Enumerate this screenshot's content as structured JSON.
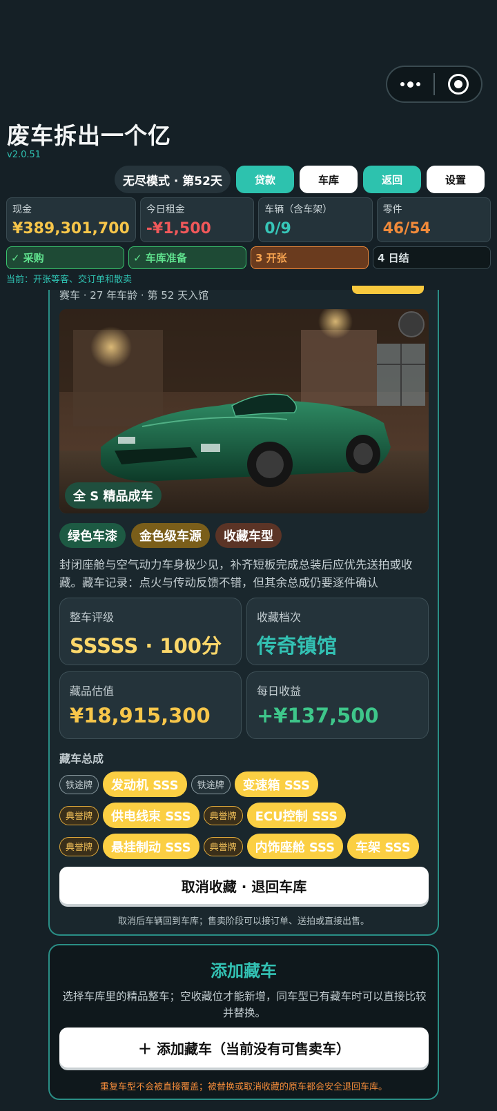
{
  "app": {
    "title": "废车拆出一个亿",
    "version": "v2.0.51"
  },
  "topbar": {
    "mode": "无尽模式 · 第52天",
    "buttons": {
      "loan": "贷款",
      "garage": "车库",
      "back": "返回",
      "settings": "设置"
    }
  },
  "stats": [
    {
      "label": "现金",
      "value": "¥389,301,700"
    },
    {
      "label": "今日租金",
      "value": "-¥1,500"
    },
    {
      "label": "车辆（含车架）",
      "value": "0/9"
    },
    {
      "label": "零件",
      "value": "46/54"
    }
  ],
  "phases": [
    {
      "label": "✓ 采购",
      "state": "done"
    },
    {
      "label": "✓ 车库准备",
      "state": "done"
    },
    {
      "label": "3 开张",
      "state": "current"
    },
    {
      "label": "4 日结",
      "state": "todo"
    }
  ],
  "current_phase": "当前：开张等客、交订单和散卖",
  "car": {
    "meta": "赛车 · 27 年车龄 · 第 52 天入馆",
    "image_tag": "全 S 精品成车",
    "tags": [
      "绿色车漆",
      "金色级车源",
      "收藏车型"
    ],
    "description": "封闭座舱与空气动力车身极少见，补齐短板完成总装后应优先送拍或收藏。藏车记录：点火与传动反馈不错，但其余总成仍要逐件确认",
    "rating": {
      "label": "整车评级",
      "value": "SSSSS · 100分"
    },
    "tier": {
      "label": "收藏档次",
      "value": "传奇镇馆"
    },
    "valuation": {
      "label": "藏品估值",
      "value": "¥18,915,300"
    },
    "daily": {
      "label": "每日收益",
      "value": "+¥137,500"
    },
    "assembly_heading": "藏车总成",
    "assemblies": [
      [
        {
          "brand": "铁途牌",
          "part": "发动机 SSS"
        },
        {
          "brand": "铁途牌",
          "part": "变速箱 SSS"
        }
      ],
      [
        {
          "brand": "典誉牌",
          "part": "供电线束 SSS"
        },
        {
          "brand": "典誉牌",
          "part": "ECU控制 SSS"
        }
      ],
      [
        {
          "brand": "典誉牌",
          "part": "悬挂制动 SSS"
        },
        {
          "brand": "典誉牌",
          "part": "内饰座舱 SSS"
        },
        {
          "brand": "",
          "part": "车架 SSS"
        }
      ]
    ],
    "cancel_button": "取消收藏 · 退回车库",
    "cancel_note": "取消后车辆回到车库；售卖阶段可以接订单、送拍或直接出售。"
  },
  "add_panel": {
    "title": "添加藏车",
    "description": "选择车库里的精品整车；空收藏位才能新增，同车型已有藏车时可以直接比较并替换。",
    "button": "＋ 添加藏车（当前没有可售卖车）",
    "warning": "重复车型不会被直接覆盖；被替换或取消收藏的原车都会安全退回车库。"
  },
  "colors": {
    "background": "#152026",
    "accent_teal": "#2dc2ae",
    "gold": "#f7c64a",
    "red": "#f0585a",
    "orange": "#f08a3a",
    "part_yellow": "#fbcf43"
  },
  "icons": [
    "more-dots-icon",
    "target-close-icon"
  ]
}
